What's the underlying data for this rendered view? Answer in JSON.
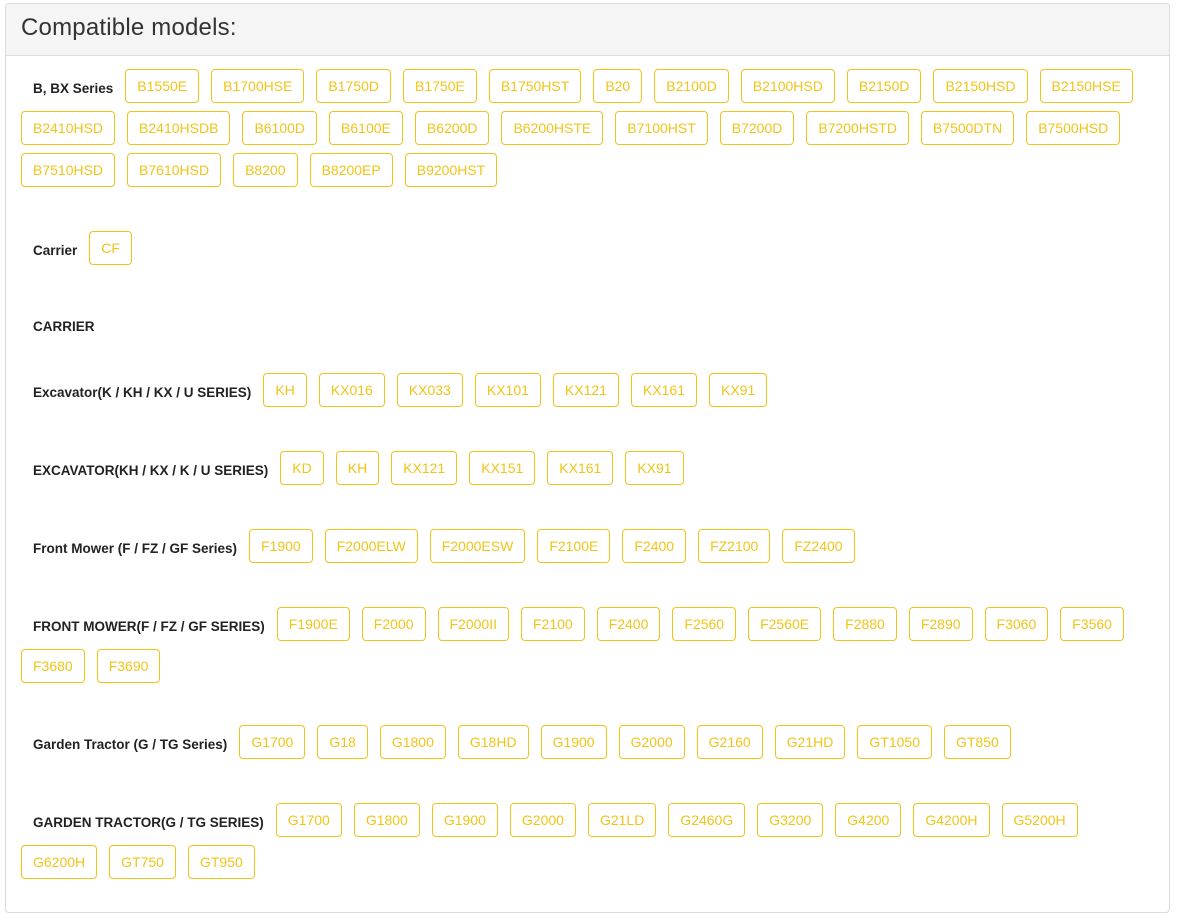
{
  "header": {
    "title": "Compatible models:"
  },
  "series": [
    {
      "label": "B, BX Series",
      "models": [
        "B1550E",
        "B1700HSE",
        "B1750D",
        "B1750E",
        "B1750HST",
        "B20",
        "B2100D",
        "B2100HSD",
        "B2150D",
        "B2150HSD",
        "B2150HSE",
        "B2410HSD",
        "B2410HSDB",
        "B6100D",
        "B6100E",
        "B6200D",
        "B6200HSTE",
        "B7100HST",
        "B7200D",
        "B7200HSTD",
        "B7500DTN",
        "B7500HSD",
        "B7510HSD",
        "B7610HSD",
        "B8200",
        "B8200EP",
        "B9200HST"
      ]
    },
    {
      "label": "Carrier",
      "models": [
        "CF"
      ]
    },
    {
      "label": "CARRIER",
      "models": []
    },
    {
      "label": "Excavator(K / KH / KX / U SERIES)",
      "models": [
        "KH",
        "KX016",
        "KX033",
        "KX101",
        "KX121",
        "KX161",
        "KX91"
      ]
    },
    {
      "label": "EXCAVATOR(KH / KX / K / U SERIES)",
      "models": [
        "KD",
        "KH",
        "KX121",
        "KX151",
        "KX161",
        "KX91"
      ]
    },
    {
      "label": "Front Mower (F / FZ / GF Series)",
      "models": [
        "F1900",
        "F2000ELW",
        "F2000ESW",
        "F2100E",
        "F2400",
        "FZ2100",
        "FZ2400"
      ]
    },
    {
      "label": "FRONT MOWER(F / FZ / GF SERIES)",
      "models": [
        "F1900E",
        "F2000",
        "F2000II",
        "F2100",
        "F2400",
        "F2560",
        "F2560E",
        "F2880",
        "F2890",
        "F3060",
        "F3560",
        "F3680",
        "F3690"
      ]
    },
    {
      "label": "Garden Tractor (G / TG Series)",
      "models": [
        "G1700",
        "G18",
        "G1800",
        "G18HD",
        "G1900",
        "G2000",
        "G2160",
        "G21HD",
        "GT1050",
        "GT850"
      ]
    },
    {
      "label": "GARDEN TRACTOR(G / TG SERIES)",
      "models": [
        "G1700",
        "G1800",
        "G1900",
        "G2000",
        "G21LD",
        "G2460G",
        "G3200",
        "G4200",
        "G4200H",
        "G5200H",
        "G6200H",
        "GT750",
        "GT950"
      ]
    }
  ]
}
